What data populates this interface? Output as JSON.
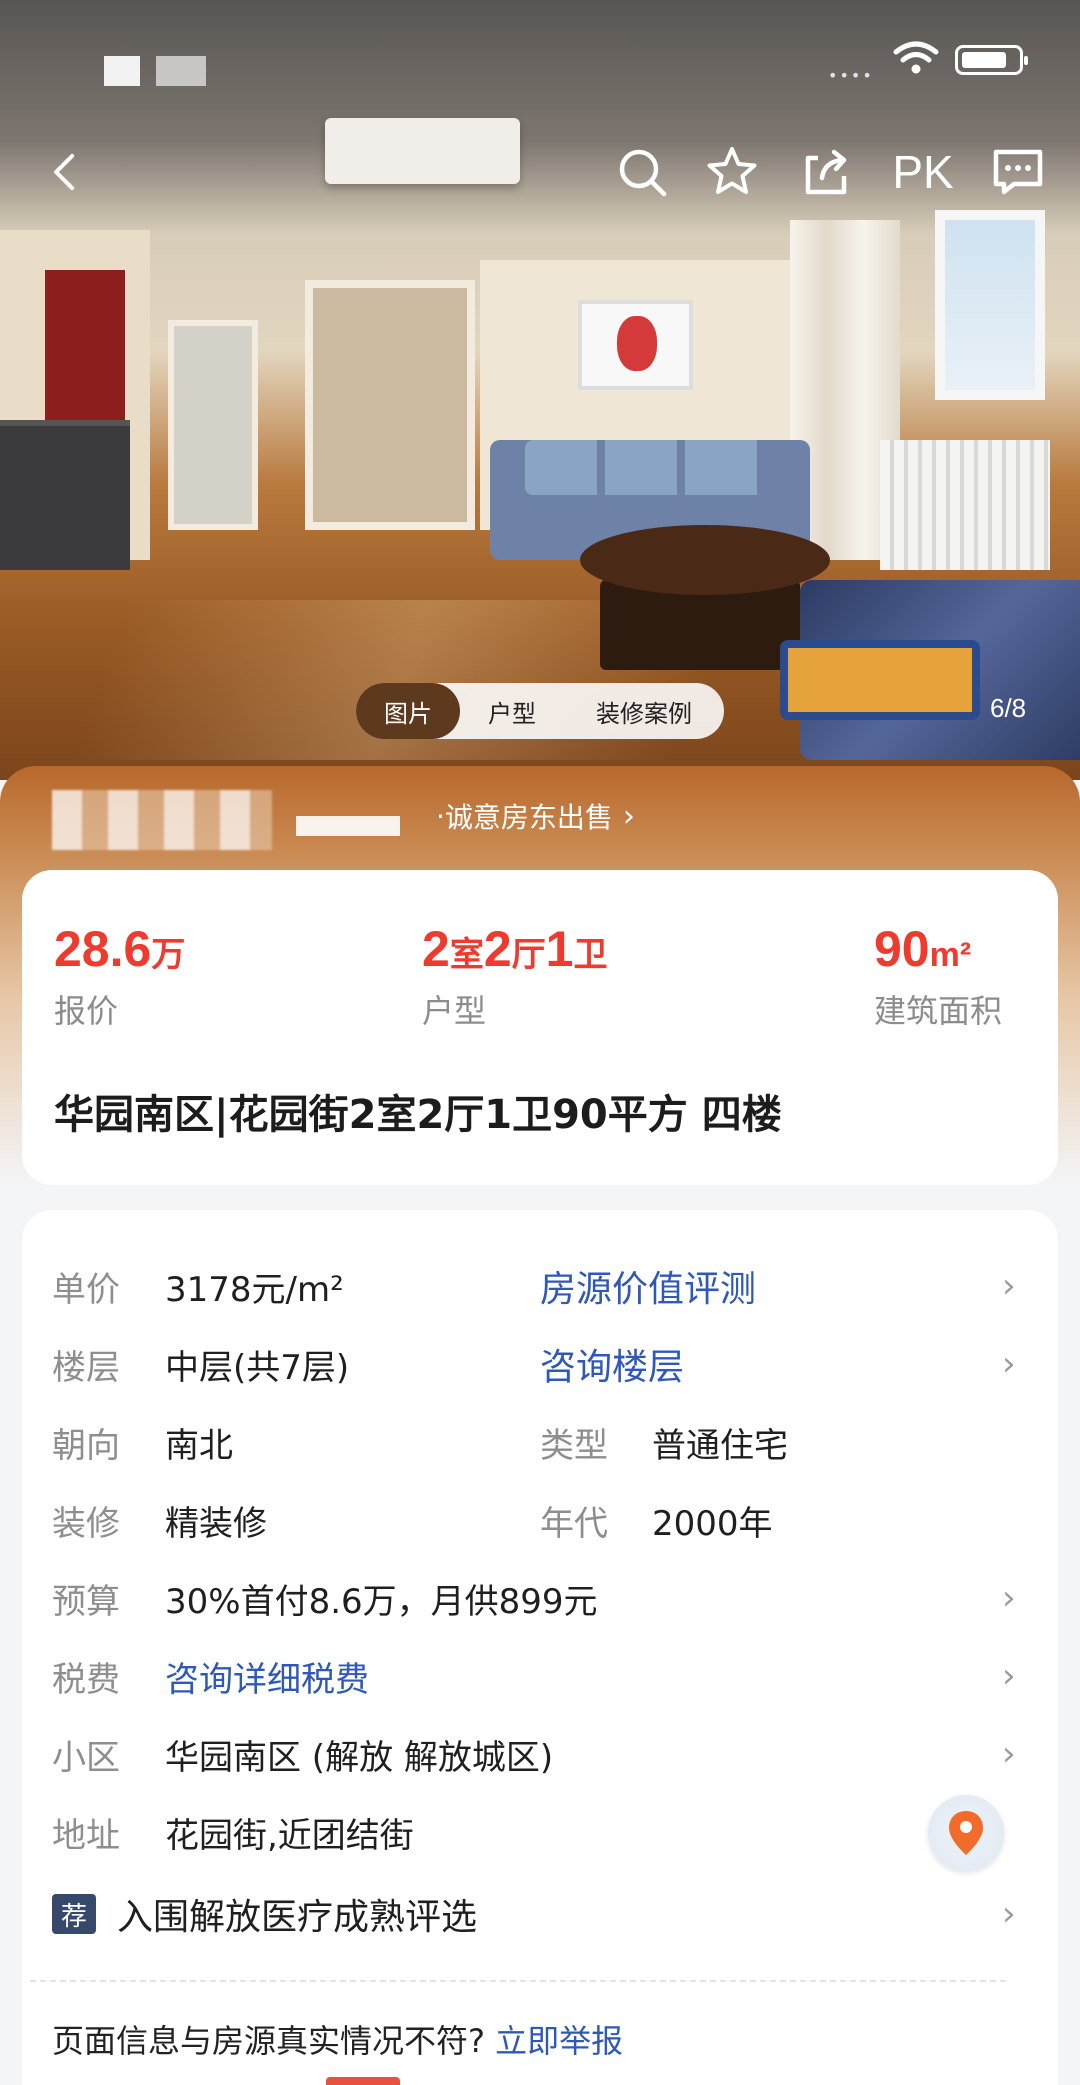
{
  "photo": {
    "tabs": [
      "图片",
      "户型",
      "装修案例"
    ],
    "counter": "6/8"
  },
  "nav": {
    "pk_label": "PK"
  },
  "banner": {
    "link_text": "诚意房东出售",
    "prefix": "· "
  },
  "price_card": {
    "price": {
      "value": "28.6",
      "unit": "万",
      "label": "报价"
    },
    "layout": {
      "n1": "2",
      "u1": "室",
      "n2": "2",
      "u2": "厅",
      "n3": "1",
      "u3": "卫",
      "label": "户型"
    },
    "area": {
      "value": "90",
      "unit": "m²",
      "label": "建筑面积"
    },
    "title": "华园南区|花园街2室2厅1卫90平方 四楼"
  },
  "details": {
    "unit_price": {
      "label": "单价",
      "value": "3178元/m²",
      "link": "房源价值评测"
    },
    "floor": {
      "label": "楼层",
      "value": "中层(共7层)",
      "link": "咨询楼层"
    },
    "orientation": {
      "label": "朝向",
      "value": "南北",
      "label2": "类型",
      "value2": "普通住宅"
    },
    "decoration": {
      "label": "装修",
      "value": "精装修",
      "label2": "年代",
      "value2": "2000年"
    },
    "budget": {
      "label": "预算",
      "value": "30%首付8.6万，月供899元"
    },
    "tax": {
      "label": "税费",
      "value": "咨询详细税费"
    },
    "community": {
      "label": "小区",
      "value": "华园南区 (解放 解放城区)"
    },
    "address": {
      "label": "地址",
      "value": "花园街,近团结街"
    },
    "recommend": {
      "badge": "荐",
      "text": "入围解放医疗成熟评选"
    }
  },
  "footer": {
    "report_text": "页面信息与房源真实情况不符?",
    "report_link": "立即举报"
  },
  "colors": {
    "price_red": "#ef3a2e",
    "link_blue": "#2f58b8",
    "tab_active": "#5d3a1e",
    "banner_orange": "#b8682c"
  }
}
